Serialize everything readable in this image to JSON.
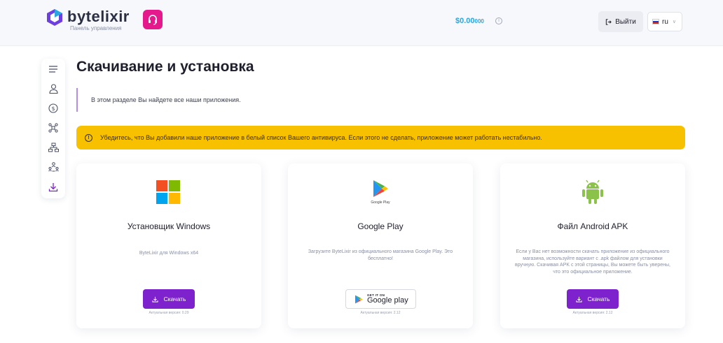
{
  "header": {
    "logo_name": "bytelixir",
    "logo_subtitle": "Панель управления",
    "balance_main": "$0.00",
    "balance_small": "000",
    "balance_info_icon": "i",
    "logout_label": "Выйти",
    "language": "ru",
    "colors": {
      "accent": "#7e22ce",
      "support": "#e5198b",
      "balance": "#2aa6e0"
    }
  },
  "sidebar": {
    "items": [
      {
        "icon": "menu-icon"
      },
      {
        "icon": "user-icon"
      },
      {
        "icon": "dollar-icon"
      },
      {
        "icon": "network-icon"
      },
      {
        "icon": "hierarchy-icon"
      },
      {
        "icon": "referrals-icon"
      },
      {
        "icon": "download-icon",
        "active": true
      }
    ]
  },
  "main": {
    "title": "Скачивание и установка",
    "intro": "В этом разделе Вы найдете все наши приложения.",
    "warning_icon": "!",
    "warning": "Убедитесь, что Вы добавили наше приложение в белый список Вашего антивируса. Если этого не сделать, приложение может работать нестабильно.",
    "cards": [
      {
        "title": "Установщик Windows",
        "description": "ByteLixir для Windows x64",
        "button_label": "Скачать",
        "version": "Актуальная версия: 0.29"
      },
      {
        "title": "Google Play",
        "logo_caption": "Google Play",
        "description": "Загрузите ByteLixir из официального магазина Google Play. Это бесплатно!",
        "badge_small": "GET IT ON",
        "badge_big": "Google play",
        "version": "Актуальная версия: 2.12"
      },
      {
        "title": "Файл Android APK",
        "description": "Если у Вас нет возможности скачать приложение из официального магазина, используйте вариант с .apk файлом для установки вручную. Скачивая APK с этой страницы, Вы можете быть уверены, что это официальное приложение.",
        "button_label": "Скачать",
        "version": "Актуальная версия: 2.12"
      }
    ]
  }
}
